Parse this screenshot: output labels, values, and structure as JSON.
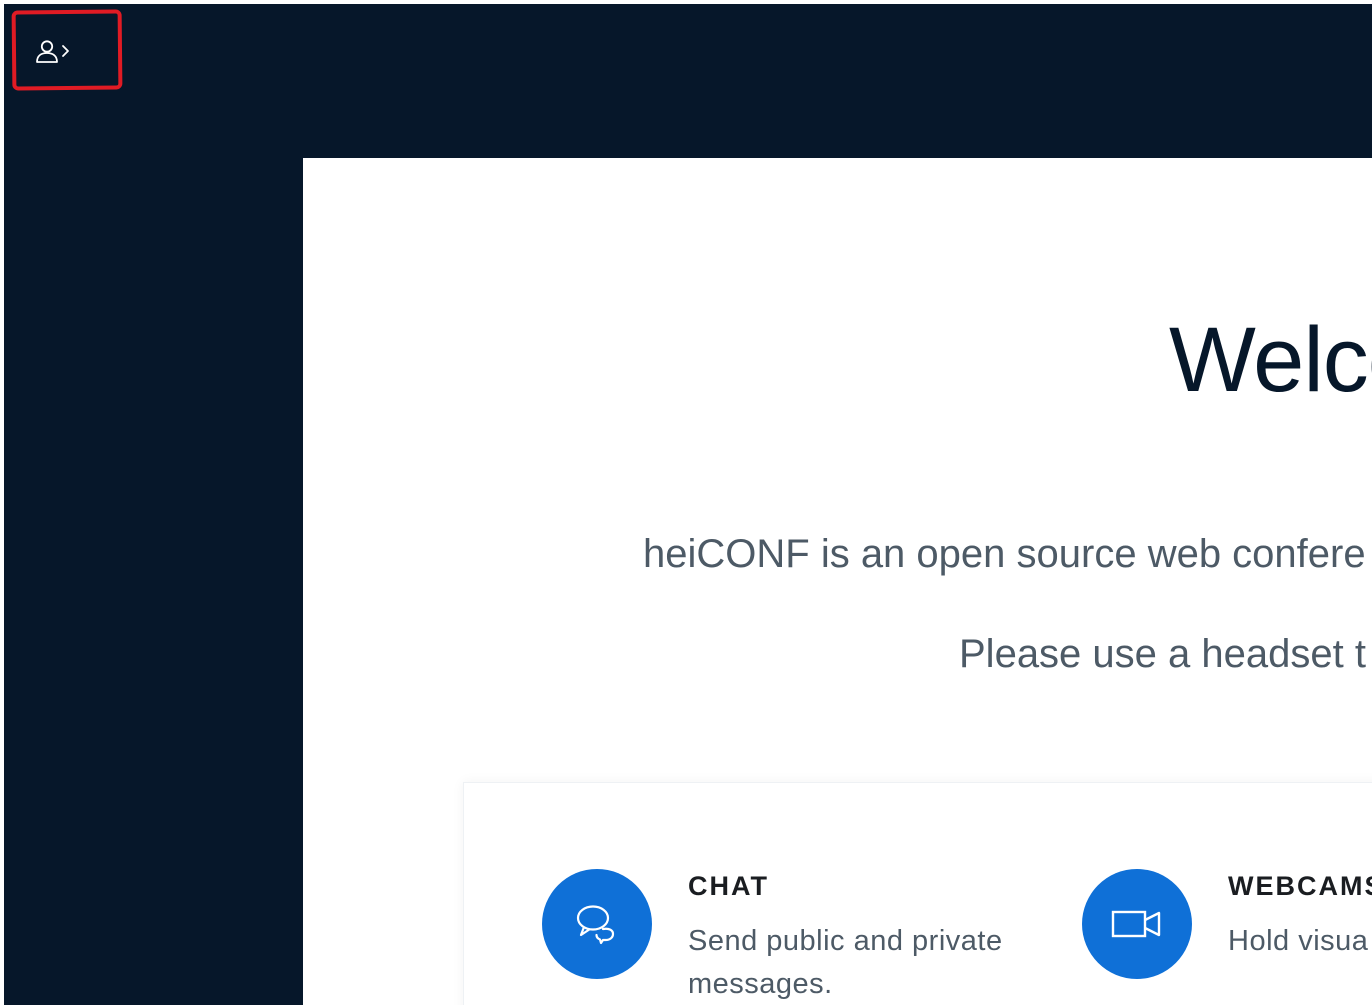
{
  "colors": {
    "background": "#06172a",
    "accent": "#0f70d7",
    "title": "#06172a",
    "body_text": "#4d5a66",
    "annotation": "#e01b24"
  },
  "toolbar": {
    "userlist_toggle_icon": "user-chevron-right-icon"
  },
  "welcome": {
    "title": "Welco",
    "intro": "heiCONF is an open source web confere",
    "headset_note": "Please use a headset t"
  },
  "features": [
    {
      "icon": "chat-bubbles-icon",
      "title": "CHAT",
      "description": "Send public and private messages."
    },
    {
      "icon": "video-camera-icon",
      "title": "WEBCAMS",
      "description": "Hold visua"
    }
  ]
}
